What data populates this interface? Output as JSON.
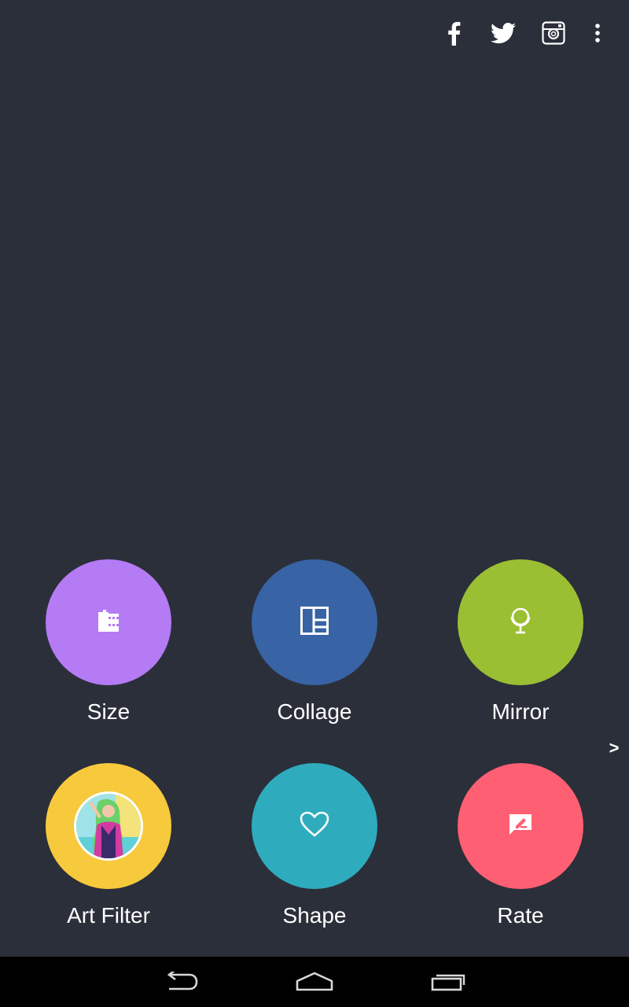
{
  "header": {
    "icons": [
      "facebook-icon",
      "twitter-icon",
      "instagram-icon",
      "more-vert-icon"
    ]
  },
  "tiles": [
    {
      "label": "Size",
      "icon": "size-icon",
      "color": "#b47bf4"
    },
    {
      "label": "Collage",
      "icon": "collage-icon",
      "color": "#3863a4"
    },
    {
      "label": "Mirror",
      "icon": "mirror-icon",
      "color": "#9bbf33"
    },
    {
      "label": "Art Filter",
      "icon": "art-filter-thumbnail",
      "color": "#f7c93d"
    },
    {
      "label": "Shape",
      "icon": "heart-icon",
      "color": "#2eacbd"
    },
    {
      "label": "Rate",
      "icon": "rate-icon",
      "color": "#ff5f72"
    }
  ],
  "pager": {
    "next_label": ">"
  },
  "navbar": {
    "icons": [
      "back-icon",
      "home-icon",
      "recent-apps-icon"
    ]
  },
  "colors": {
    "background": "#2b2f3a",
    "navbar": "#000000"
  }
}
